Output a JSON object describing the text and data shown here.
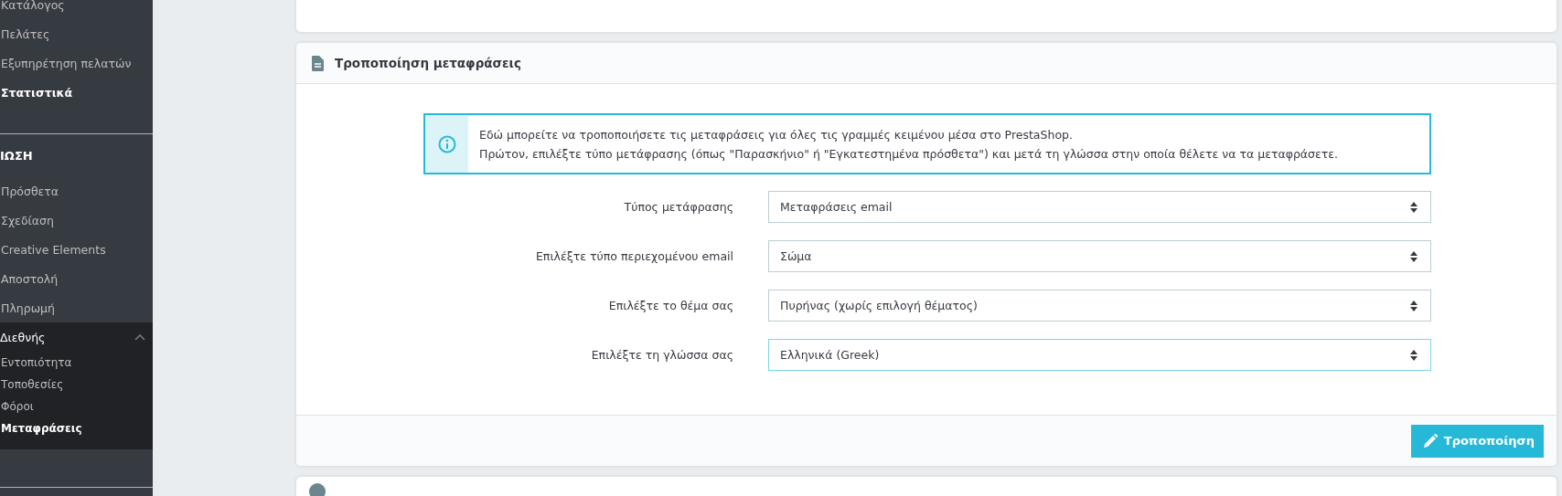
{
  "sidebar": {
    "top_items": [
      {
        "label": "Κατάλογος",
        "selected": false
      },
      {
        "label": "Πελάτες",
        "selected": false
      },
      {
        "label": "Εξυπηρέτηση πελατών",
        "selected": false
      },
      {
        "label": "Στατιστικά",
        "selected": true
      }
    ],
    "section_title": "ΙΩΣΗ",
    "section_items": [
      {
        "label": "Πρόσθετα",
        "selected": false
      },
      {
        "label": "Σχεδίαση",
        "selected": false
      },
      {
        "label": "Creative Elements",
        "selected": false
      },
      {
        "label": "Αποστολή",
        "selected": false
      },
      {
        "label": "Πληρωμή",
        "selected": false
      }
    ],
    "group": {
      "label": "Διεθνής",
      "expanded": true,
      "children": [
        {
          "label": "Εντοπιότητα",
          "selected": false
        },
        {
          "label": "Τοποθεσίες",
          "selected": false
        },
        {
          "label": "Φόροι",
          "selected": false
        },
        {
          "label": "Μεταφράσεις",
          "selected": true
        }
      ]
    }
  },
  "panel": {
    "title": "Τροποποίηση μεταφράσεις",
    "info": [
      "Εδώ μπορείτε να τροποποιήσετε τις μεταφράσεις για όλες τις γραμμές κειμένου μέσα στο PrestaShop.",
      "Πρώτον, επιλέξτε τύπο μετάφρασης (όπως \"Παρασκήνιο\" ή \"Εγκατεστημένα πρόσθετα\") και μετά τη γλώσσα στην οποία θέλετε να τα μεταφράσετε."
    ],
    "fields": [
      {
        "label": "Τύπος μετάφρασης",
        "value": "Μεταφράσεις email",
        "focused": false
      },
      {
        "label": "Επιλέξτε τύπο περιεχομένου email",
        "value": "Σώμα",
        "focused": false
      },
      {
        "label": "Επιλέξτε το θέμα σας",
        "value": "Πυρήνας (χωρίς επιλογή θέματος)",
        "focused": false
      },
      {
        "label": "Επιλέξτε τη γλώσσα σας",
        "value": "Ελληνικά (Greek)",
        "focused": true
      }
    ],
    "button": "Τροποποίηση"
  }
}
